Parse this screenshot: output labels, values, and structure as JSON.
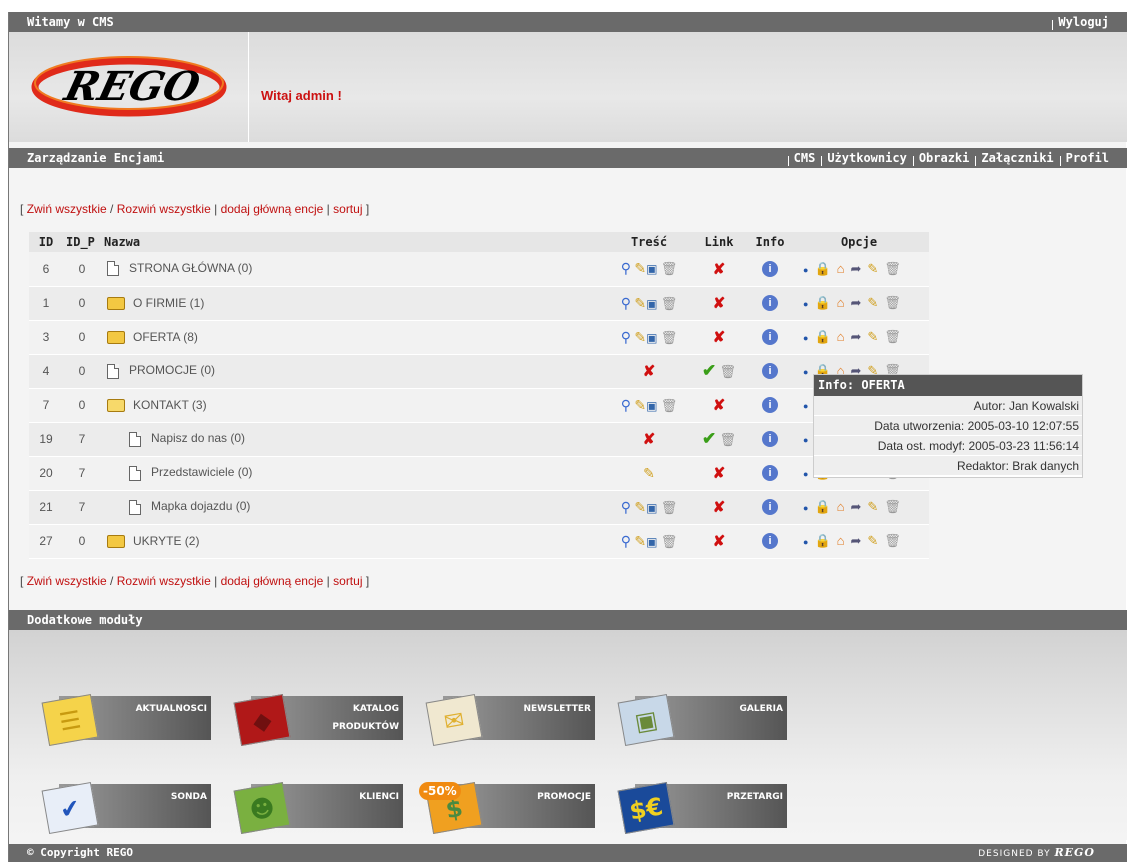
{
  "topbar": {
    "title": "Witamy w CMS",
    "logout": "Wyloguj"
  },
  "header": {
    "logo_text": "REGO",
    "welcome": "Witaj admin !"
  },
  "bar2": {
    "title": "Zarządzanie Encjami",
    "nav": [
      "CMS",
      "Użytkownicy",
      "Obrazki",
      "Załączniki",
      "Profil"
    ]
  },
  "links": {
    "open_bracket": "[",
    "collapse": "Zwiń wszystkie",
    "sep1": "/",
    "expand": "Rozwiń wszystkie",
    "sep2": "|",
    "add": "dodaj główną encje",
    "sep3": "|",
    "sort": "sortuj",
    "close_bracket": "]"
  },
  "table": {
    "headers": {
      "id": "ID",
      "idp": "ID_P",
      "name": "Nazwa",
      "content": "Treść",
      "link": "Link",
      "info": "Info",
      "options": "Opcje"
    },
    "rows": [
      {
        "id": "6",
        "idp": "0",
        "name": "STRONA GŁÓWNA (0)",
        "kind": "doc",
        "indent": 0,
        "content": "full",
        "link": "x",
        "opts": "full"
      },
      {
        "id": "1",
        "idp": "0",
        "name": "O FIRMIE (1)",
        "kind": "folder",
        "indent": 0,
        "content": "full",
        "link": "x",
        "opts": "full"
      },
      {
        "id": "3",
        "idp": "0",
        "name": "OFERTA (8)",
        "kind": "folder",
        "indent": 0,
        "content": "full",
        "link": "x",
        "opts": "full"
      },
      {
        "id": "4",
        "idp": "0",
        "name": "PROMOCJE (0)",
        "kind": "doc",
        "indent": 0,
        "content": "x",
        "link": "check",
        "opts": "full"
      },
      {
        "id": "7",
        "idp": "0",
        "name": "KONTAKT (3)",
        "kind": "folder-open",
        "indent": 0,
        "content": "full",
        "link": "x",
        "opts": "full"
      },
      {
        "id": "19",
        "idp": "7",
        "name": "Napisz do nas (0)",
        "kind": "doc",
        "indent": 1,
        "content": "x",
        "link": "check",
        "opts": "full"
      },
      {
        "id": "20",
        "idp": "7",
        "name": "Przedstawiciele (0)",
        "kind": "doc",
        "indent": 1,
        "content": "pen",
        "link": "x",
        "opts": "full"
      },
      {
        "id": "21",
        "idp": "7",
        "name": "Mapka dojazdu (0)",
        "kind": "doc",
        "indent": 1,
        "content": "full",
        "link": "x",
        "opts": "full"
      },
      {
        "id": "27",
        "idp": "0",
        "name": "UKRYTE (2)",
        "kind": "folder",
        "indent": 0,
        "content": "full",
        "link": "x",
        "opts": "full-locked"
      }
    ]
  },
  "tooltip": {
    "title": "Info: OFERTA",
    "author": "Autor: Jan Kowalski",
    "created": "Data utworzenia: 2005-03-10 12:07:55",
    "modified": "Data ost. modyf: 2005-03-23 11:56:14",
    "editor": "Redaktor: Brak danych"
  },
  "bar3": {
    "title": "Dodatkowe moduły"
  },
  "modules": [
    {
      "label": "AKTUALNOSCI",
      "label2": ""
    },
    {
      "label": "KATALOG",
      "label2": "PRODUKTÓW"
    },
    {
      "label": "NEWSLETTER",
      "label2": ""
    },
    {
      "label": "GALERIA",
      "label2": ""
    },
    {
      "label": "SONDA",
      "label2": ""
    },
    {
      "label": "KLIENCI",
      "label2": ""
    },
    {
      "label": "PROMOCJE",
      "label2": "",
      "badge": "-50%"
    },
    {
      "label": "PRZETARGI",
      "label2": ""
    }
  ],
  "footer": {
    "copyright": "© Copyright REGO",
    "designed": "DESIGNED BY",
    "designed_logo": "REGO"
  },
  "colors": {
    "bar": "#6a6a6a",
    "accent_red": "#c01010",
    "check_green": "#3a9e18"
  }
}
